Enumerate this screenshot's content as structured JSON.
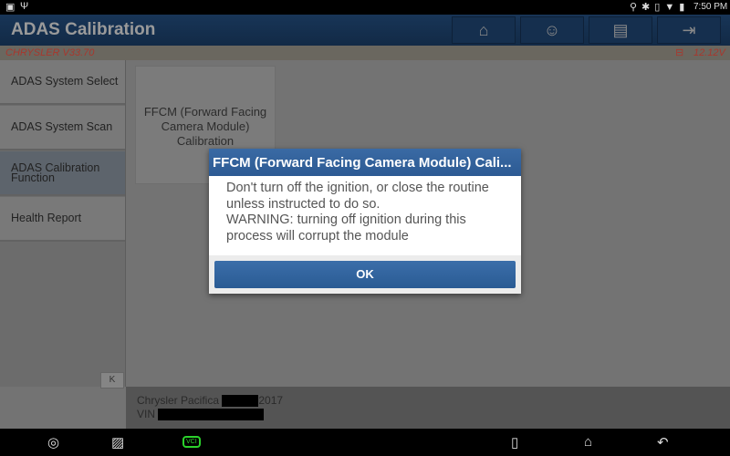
{
  "status_bar": {
    "time": "7:50 PM"
  },
  "header": {
    "title": "ADAS Calibration",
    "buttons": [
      "home-icon",
      "support-agent-icon",
      "printer-icon",
      "exit-icon"
    ]
  },
  "subheader": {
    "software": "CHRYSLER V33.70",
    "voltage": "12.12V"
  },
  "sidebar": {
    "items": [
      {
        "label": "ADAS System Select"
      },
      {
        "label": "ADAS System Scan"
      },
      {
        "label": "ADAS Calibration Function",
        "selected": true
      },
      {
        "label": "Health Report"
      }
    ],
    "collapse": "K"
  },
  "main": {
    "card": "FFCM (Forward Facing Camera Module) Calibration"
  },
  "footer": {
    "vehicle": "Chrysler Pacifica",
    "year": "2017",
    "vin_label": "VIN"
  },
  "dialog": {
    "title": "FFCM (Forward Facing Camera Module) Cali...",
    "line1": "Don't turn off the ignition, or close the routine unless instructed to do so.",
    "line2": "WARNING: turning off ignition during this process will corrupt the module",
    "ok": "OK"
  },
  "nav_bar": {
    "vci": "VCI"
  },
  "colors": {
    "header": "#183557",
    "dialog_title": "#3a6aa4",
    "ok_button": "#2a5b94",
    "subheader_text": "#a8372d",
    "vci": "#2bd12b"
  }
}
